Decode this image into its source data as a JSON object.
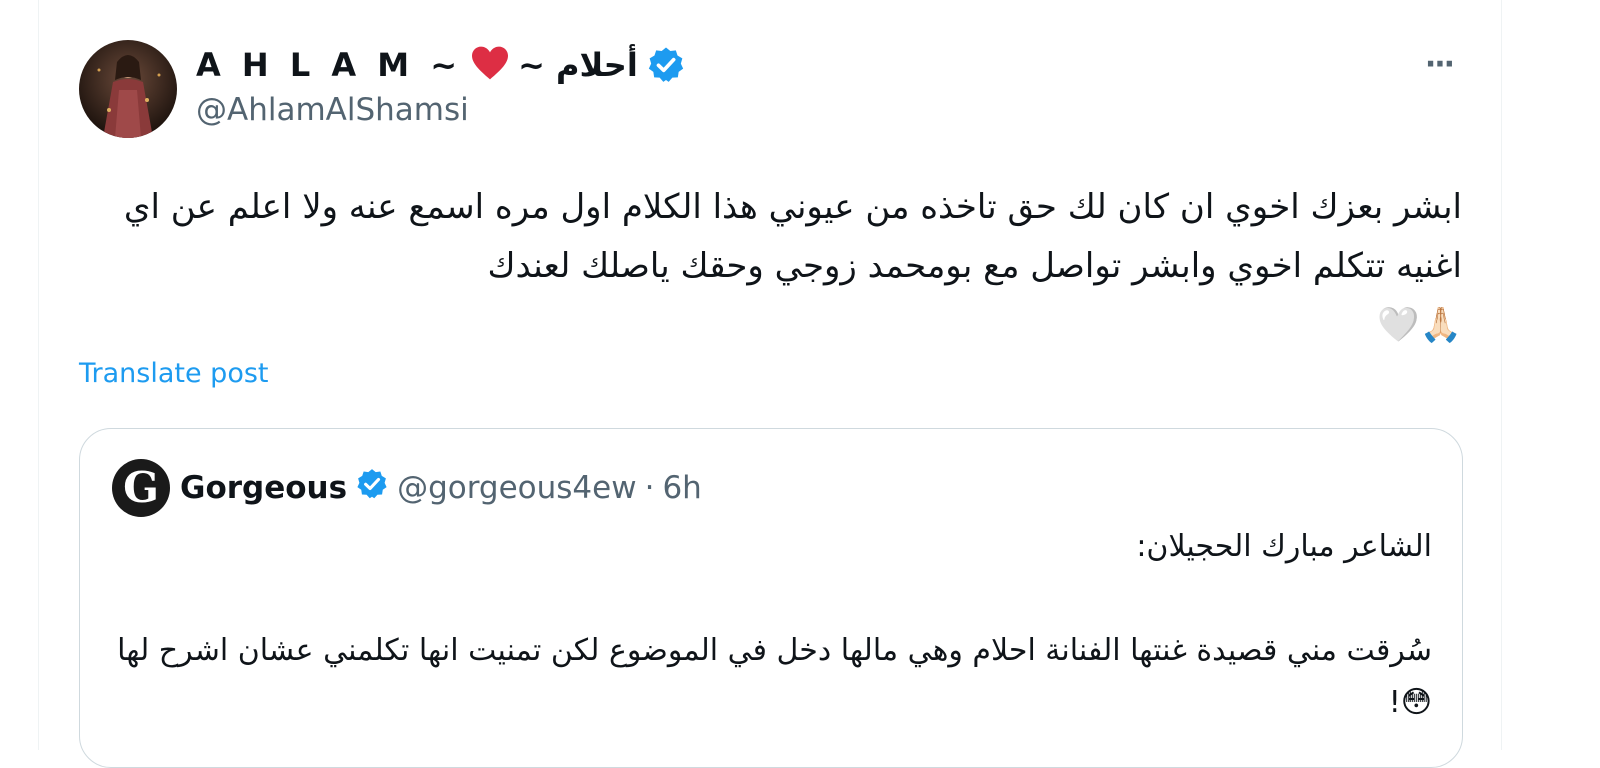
{
  "author": {
    "display_name_latin": "A H L A M ~",
    "display_name_arabic": "~ أحلام",
    "handle": "@AhlamAlShamsi",
    "avatar_icon": "profile-photo"
  },
  "post": {
    "text": "ابشر بعزك اخوي ان كان لك حق تاخذه من عيوني هذا الكلام اول مره اسمع عنه ولا اعلم عن اي اغنيه تتكلم اخوي وابشر تواصل مع بومحمد زوجي وحقك ياصلك لعندك",
    "emojis": "🙏🏻🤍"
  },
  "translate_label": "Translate post",
  "more_label": "···",
  "quote": {
    "avatar_letter": "G",
    "name": "Gorgeous",
    "handle": "@gorgeous4ew",
    "separator": "·",
    "time": "6h",
    "text": "الشاعر مبارك الحجيلان:\n\nسُرقت مني قصيدة غنتها الفنانة احلام وهي مالها دخل في الموضوع لكن تمنيت انها تكلمني عشان اشرح لها 😳!"
  },
  "colors": {
    "accent": "#1d9bf0",
    "verified": "#1d9bf0",
    "heart": "#f91880",
    "secondary_text": "#536471"
  }
}
